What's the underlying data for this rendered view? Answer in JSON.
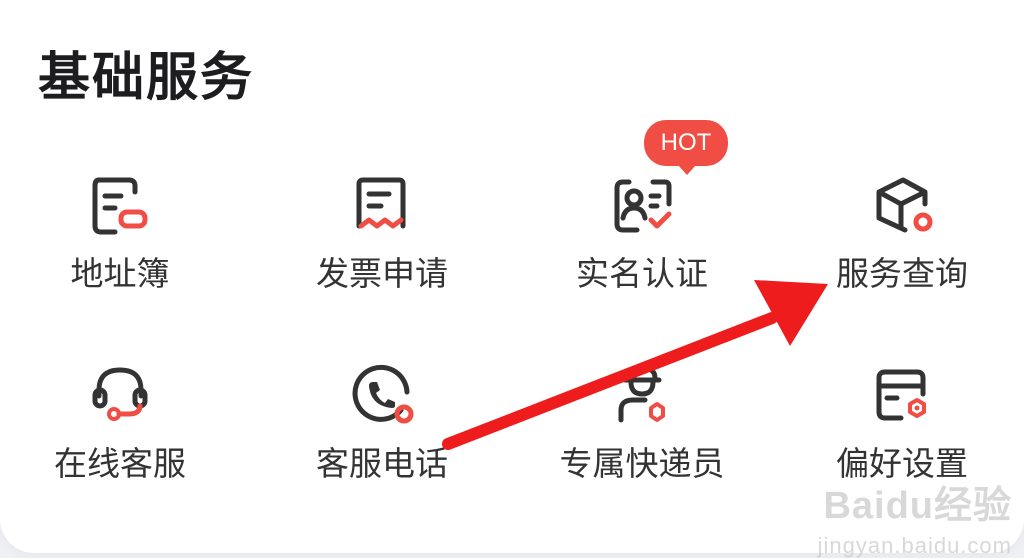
{
  "section": {
    "title": "基础服务"
  },
  "badge": {
    "label": "HOT"
  },
  "services": [
    {
      "label": "地址簿",
      "icon": "address-book-icon"
    },
    {
      "label": "发票申请",
      "icon": "invoice-icon"
    },
    {
      "label": "实名认证",
      "icon": "id-card-icon"
    },
    {
      "label": "服务查询",
      "icon": "package-box-icon"
    },
    {
      "label": "在线客服",
      "icon": "headset-icon"
    },
    {
      "label": "客服电话",
      "icon": "phone-icon"
    },
    {
      "label": "专属快递员",
      "icon": "courier-icon"
    },
    {
      "label": "偏好设置",
      "icon": "preference-card-icon"
    }
  ],
  "watermark": {
    "brand": "Baidu经验",
    "domain": "jingyan.baidu.com"
  },
  "colors": {
    "accent": "#f04e44",
    "icon_stroke": "#333333",
    "text": "#333333",
    "title": "#1d1d1f",
    "arrow": "#ee1c1c"
  }
}
